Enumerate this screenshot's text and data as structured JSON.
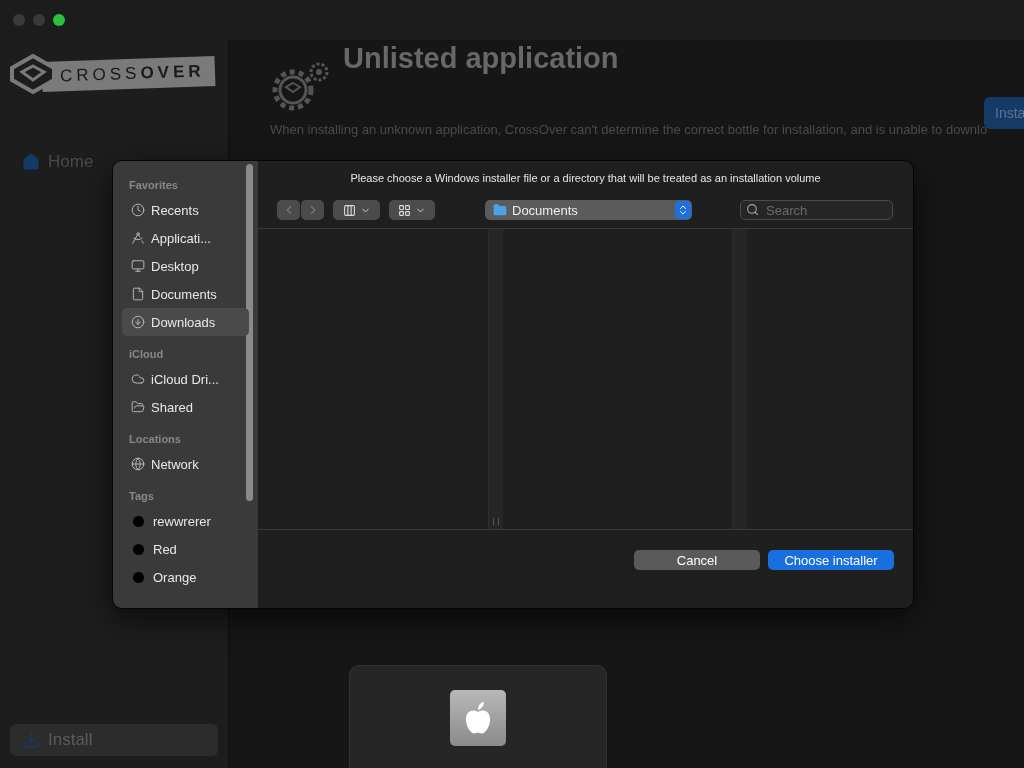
{
  "app": {
    "logo": "CROSS**OVER**",
    "nav": [
      {
        "label": "Home",
        "selected": false
      },
      {
        "label": "Install",
        "selected": true
      }
    ],
    "page_title": "Unlisted application",
    "install_button": "Insta",
    "description": "When installing an unknown application, CrossOver can't determine the correct bottle for installation, and is unable to downlo"
  },
  "dialog": {
    "message": "Please choose a Windows installer file or a directory that will be treated as an installation volume",
    "sidebar": [
      {
        "heading": "Favorites",
        "items": [
          {
            "label": "Recents",
            "selected": false
          },
          {
            "label": "Applicati...",
            "selected": false
          },
          {
            "label": "Desktop",
            "selected": false
          },
          {
            "label": "Documents",
            "selected": false
          },
          {
            "label": "Downloads",
            "selected": true
          }
        ]
      },
      {
        "heading": "iCloud",
        "items": [
          {
            "label": "iCloud Dri...",
            "selected": false
          },
          {
            "label": "Shared",
            "selected": false
          }
        ]
      },
      {
        "heading": "Locations",
        "items": [
          {
            "label": "Network",
            "selected": false
          }
        ]
      },
      {
        "heading": "Tags",
        "items": [
          {
            "label": "rewwrerer",
            "selected": false
          },
          {
            "label": "Red",
            "selected": false
          },
          {
            "label": "Orange",
            "selected": false
          }
        ]
      }
    ],
    "location": "Documents",
    "search": {
      "placeholder": "Search"
    },
    "buttons": [
      {
        "label": "Cancel",
        "kind": "secondary"
      },
      {
        "label": "Choose installer",
        "kind": "primary"
      }
    ]
  }
}
